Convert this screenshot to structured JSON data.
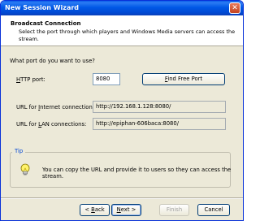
{
  "window": {
    "title": "New Session Wizard",
    "close_glyph": "✕"
  },
  "header": {
    "title": "Broadcast Connection",
    "description": "Select the port through which players and Windows Media servers can access the stream."
  },
  "main": {
    "question": "What port do you want to use?",
    "http_port": {
      "label_prefix": "H",
      "label_rest": "TTP port:",
      "value": "8080"
    },
    "find_port_button": {
      "mnemonic": "F",
      "rest": "ind Free Port"
    },
    "internet_url": {
      "label_prefix": "URL for ",
      "mnemonic": "I",
      "label_rest": "nternet connections:",
      "value": "http://192.168.1.128:8080/"
    },
    "lan_url": {
      "label_prefix": "URL for ",
      "mnemonic": "L",
      "label_rest": "AN connections:",
      "value": "http://epiphan-606baca:8080/"
    }
  },
  "tip": {
    "label": "Tip",
    "text": "You can copy the URL and provide it to users so they can access the stream.",
    "icon": "lightbulb-icon"
  },
  "footer": {
    "back": {
      "prefix": "< ",
      "mnemonic": "B",
      "rest": "ack"
    },
    "next": {
      "mnemonic": "N",
      "rest": "ext >"
    },
    "finish": "Finish",
    "cancel": "Cancel"
  }
}
